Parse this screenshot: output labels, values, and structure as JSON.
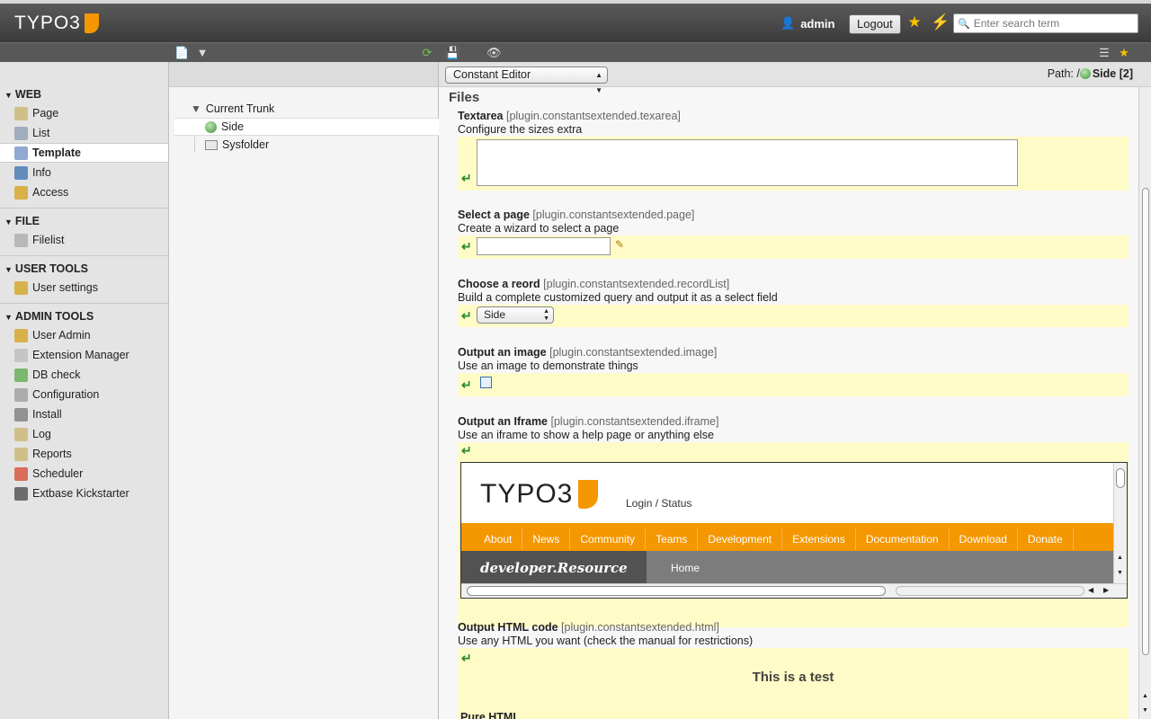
{
  "app": {
    "logo_text": "TYPO3",
    "username": "admin",
    "logout_label": "Logout",
    "search_placeholder": "Enter search term"
  },
  "module_menu": [
    {
      "section": "WEB",
      "items": [
        {
          "label": "Page",
          "icon": "page-edit-icon",
          "active": false
        },
        {
          "label": "List",
          "icon": "list-icon",
          "active": false
        },
        {
          "label": "Template",
          "icon": "template-icon",
          "active": true
        },
        {
          "label": "Info",
          "icon": "info-icon",
          "active": false
        },
        {
          "label": "Access",
          "icon": "lock-icon",
          "active": false
        }
      ]
    },
    {
      "section": "FILE",
      "items": [
        {
          "label": "Filelist",
          "icon": "filelist-icon",
          "active": false
        }
      ]
    },
    {
      "section": "USER TOOLS",
      "items": [
        {
          "label": "User settings",
          "icon": "user-settings-icon",
          "active": false
        }
      ]
    },
    {
      "section": "ADMIN TOOLS",
      "items": [
        {
          "label": "User Admin",
          "icon": "user-admin-icon",
          "active": false
        },
        {
          "label": "Extension Manager",
          "icon": "extension-icon",
          "active": false
        },
        {
          "label": "DB check",
          "icon": "db-check-icon",
          "active": false
        },
        {
          "label": "Configuration",
          "icon": "configuration-icon",
          "active": false
        },
        {
          "label": "Install",
          "icon": "install-icon",
          "active": false
        },
        {
          "label": "Log",
          "icon": "log-icon",
          "active": false
        },
        {
          "label": "Reports",
          "icon": "reports-icon",
          "active": false
        },
        {
          "label": "Scheduler",
          "icon": "scheduler-icon",
          "active": false
        },
        {
          "label": "Extbase Kickstarter",
          "icon": "typo3-icon",
          "active": false
        }
      ]
    }
  ],
  "page_tree": {
    "root": "Current Trunk",
    "nodes": [
      "Side",
      "Sysfolder"
    ]
  },
  "docheader": {
    "view_select": "Constant Editor",
    "path_label": "Path: /",
    "path_page": "Side [2]"
  },
  "section_title": "Files",
  "constants": [
    {
      "title": "Textarea",
      "key": "[plugin.constantsextended.texarea]",
      "desc": "Configure the sizes extra"
    },
    {
      "title": "Select a page",
      "key": "[plugin.constantsextended.page]",
      "desc": "Create a wizard to select a page"
    },
    {
      "title": "Choose a reord",
      "key": "[plugin.constantsextended.recordList]",
      "desc": "Build a complete customized query and output it as a select field",
      "select_value": "Side"
    },
    {
      "title": "Output an image",
      "key": "[plugin.constantsextended.image]",
      "desc": "Use an image to demonstrate things"
    },
    {
      "title": "Output an Iframe",
      "key": "[plugin.constantsextended.iframe]",
      "desc": "Use an iframe to show a help page or anything else"
    },
    {
      "title": "Output HTML code",
      "key": "[plugin.constantsextended.html]",
      "desc": "Use any HTML you want (check the manual for restrictions)"
    }
  ],
  "iframe_page": {
    "logo_text": "TYPO3",
    "login_status": "Login / Status",
    "nav": [
      "About",
      "News",
      "Community",
      "Teams",
      "Development",
      "Extensions",
      "Documentation",
      "Download",
      "Donate"
    ],
    "brand": "developer.Resource",
    "home": "Home"
  },
  "html_output": {
    "heading": "This is a test",
    "text": "Pure HTML"
  },
  "colors": {
    "accent": "#f49700",
    "highlight": "#fefbc7",
    "topbar": "#3b3b3b"
  }
}
